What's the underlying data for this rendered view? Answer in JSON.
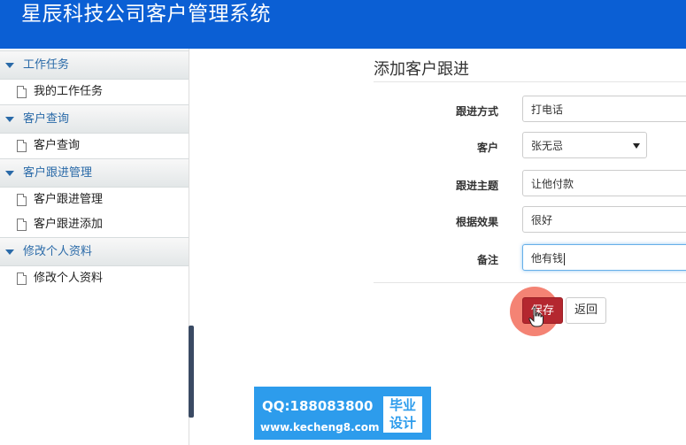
{
  "header": {
    "title": "星辰科技公司客户管理系统"
  },
  "sidebar": {
    "groups": [
      {
        "label": "工作任务",
        "items": [
          "我的工作任务"
        ]
      },
      {
        "label": "客户查询",
        "items": [
          "客户查询"
        ]
      },
      {
        "label": "客户跟进管理",
        "items": [
          "客户跟进管理",
          "客户跟进添加"
        ]
      },
      {
        "label": "修改个人资料",
        "items": [
          "修改个人资料"
        ]
      }
    ]
  },
  "main": {
    "title": "添加客户跟进",
    "form": {
      "method_label": "跟进方式",
      "method_value": "打电话",
      "customer_label": "客户",
      "customer_value": "张无忌",
      "subject_label": "跟进主题",
      "subject_value": "让他付款",
      "result_label": "根据效果",
      "result_value": "很好",
      "note_label": "备注",
      "note_value": "他有钱"
    },
    "buttons": {
      "save": "保存",
      "back": "返回"
    }
  },
  "watermark": {
    "qq": "QQ:188083800",
    "url": "www.kecheng8.com",
    "badge_line1": "毕业",
    "badge_line2": "设计"
  },
  "colors": {
    "header_bg": "#0b5fd4",
    "save_button": "#b4272f",
    "watermark_bg": "#2d9cec"
  }
}
